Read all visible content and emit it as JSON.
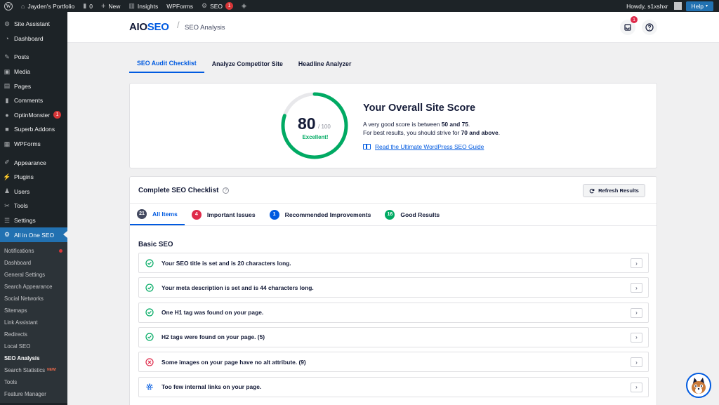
{
  "admin_bar": {
    "site_name": "Jayden's Portfolio",
    "comments_count": "0",
    "new_label": "New",
    "insights_label": "Insights",
    "wpforms_label": "WPForms",
    "seo_label": "SEO",
    "seo_badge": "1",
    "howdy": "Howdy, s1xshxr",
    "help_label": "Help"
  },
  "sidebar": {
    "items": [
      {
        "label": "Site Assistant",
        "icon": "gear-icon"
      },
      {
        "label": "Dashboard",
        "icon": "dashboard-icon"
      },
      {
        "label": "Posts",
        "icon": "pin-icon"
      },
      {
        "label": "Media",
        "icon": "media-icon"
      },
      {
        "label": "Pages",
        "icon": "pages-icon"
      },
      {
        "label": "Comments",
        "icon": "comment-icon"
      },
      {
        "label": "OptinMonster",
        "icon": "optinmonster-icon",
        "badge": "1"
      },
      {
        "label": "Superb Addons",
        "icon": "addons-icon"
      },
      {
        "label": "WPForms",
        "icon": "forms-icon"
      },
      {
        "label": "Appearance",
        "icon": "brush-icon"
      },
      {
        "label": "Plugins",
        "icon": "plug-icon"
      },
      {
        "label": "Users",
        "icon": "user-icon"
      },
      {
        "label": "Tools",
        "icon": "wrench-icon"
      },
      {
        "label": "Settings",
        "icon": "settings-icon"
      },
      {
        "label": "All in One SEO",
        "icon": "aioseo-icon"
      }
    ],
    "submenu": [
      {
        "label": "Notifications"
      },
      {
        "label": "Dashboard"
      },
      {
        "label": "General Settings"
      },
      {
        "label": "Search Appearance"
      },
      {
        "label": "Social Networks"
      },
      {
        "label": "Sitemaps"
      },
      {
        "label": "Link Assistant"
      },
      {
        "label": "Redirects"
      },
      {
        "label": "Local SEO"
      },
      {
        "label": "SEO Analysis"
      },
      {
        "label": "Search Statistics",
        "tag": "NEW!"
      },
      {
        "label": "Tools"
      },
      {
        "label": "Feature Manager"
      }
    ]
  },
  "header": {
    "logo_aio": "AIO",
    "logo_seo": "SEO",
    "separator": "/",
    "page_title": "SEO Analysis",
    "notification_badge": "1"
  },
  "tabs": [
    {
      "label": "SEO Audit Checklist",
      "active": true
    },
    {
      "label": "Analyze Competitor Site"
    },
    {
      "label": "Headline Analyzer"
    }
  ],
  "score": {
    "value": 80,
    "value_text": "80",
    "max_text": "/ 100",
    "rating": "Excellent!",
    "title": "Your Overall Site Score",
    "line1_pre": "A very good score is between ",
    "line1_bold": "50 and 75",
    "line1_post": ".",
    "line2_pre": "For best results, you should strive for ",
    "line2_bold": "70 and above",
    "line2_post": ".",
    "guide_link": "Read the Ultimate WordPress SEO Guide",
    "colors": {
      "good": "#00aa63",
      "track": "#e8e8eb"
    }
  },
  "checklist": {
    "title": "Complete SEO Checklist",
    "refresh_label": "Refresh Results",
    "tabs": [
      {
        "count": "21",
        "label": "All Items",
        "color": "#434960",
        "active": true
      },
      {
        "count": "4",
        "label": "Important Issues",
        "color": "#df2a4a"
      },
      {
        "count": "1",
        "label": "Recommended Improvements",
        "color": "#005ae0"
      },
      {
        "count": "16",
        "label": "Good Results",
        "color": "#00aa63"
      }
    ],
    "section_title": "Basic SEO",
    "rows": [
      {
        "text": "Your SEO title is set and is 20 characters long.",
        "status": "good"
      },
      {
        "text": "Your meta description is set and is 44 characters long.",
        "status": "good"
      },
      {
        "text": "One H1 tag was found on your page.",
        "status": "good"
      },
      {
        "text": "H2 tags were found on your page. (5)",
        "status": "good"
      },
      {
        "text": "Some images on your page have no alt attribute. (9)",
        "status": "error"
      },
      {
        "text": "Too few internal links on your page.",
        "status": "improve"
      }
    ]
  }
}
